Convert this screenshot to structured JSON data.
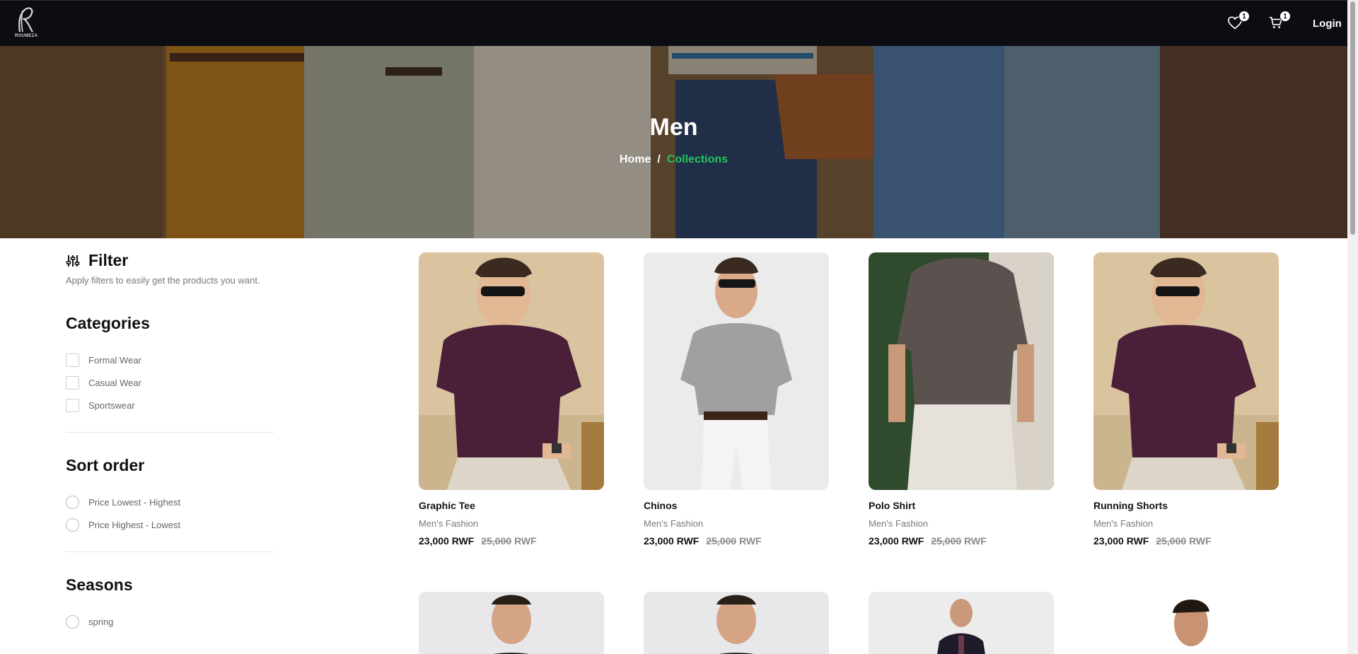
{
  "header": {
    "logo_text": "ROUMEZA",
    "wishlist_count": "1",
    "cart_count": "1",
    "login_label": "Login",
    "icons": [
      "heart-icon",
      "cart-icon"
    ]
  },
  "hero": {
    "title": "Men",
    "breadcrumb": {
      "home": "Home",
      "separator": "/",
      "current": "Collections"
    }
  },
  "filter": {
    "title": "Filter",
    "subtitle": "Apply filters to easily get the products you want.",
    "categories": {
      "title": "Categories",
      "options": [
        "Formal Wear",
        "Casual Wear",
        "Sportswear"
      ]
    },
    "sort": {
      "title": "Sort order",
      "options": [
        "Price Lowest - Highest",
        "Price Highest - Lowest"
      ]
    },
    "seasons": {
      "title": "Seasons",
      "options": [
        "spring"
      ]
    }
  },
  "products": [
    {
      "name": "Graphic Tee",
      "category": "Men's Fashion",
      "price": "23,000 RWF",
      "old_price": "25,000",
      "old_unit": "RWF"
    },
    {
      "name": "Chinos",
      "category": "Men's Fashion",
      "price": "23,000 RWF",
      "old_price": "25,000",
      "old_unit": "RWF"
    },
    {
      "name": "Polo Shirt",
      "category": "Men's Fashion",
      "price": "23,000 RWF",
      "old_price": "25,000",
      "old_unit": "RWF"
    },
    {
      "name": "Running Shorts",
      "category": "Men's Fashion",
      "price": "23,000 RWF",
      "old_price": "25,000",
      "old_unit": "RWF"
    }
  ],
  "colors": {
    "topbar": "#0b0d13",
    "accent_green": "#22c55e"
  }
}
